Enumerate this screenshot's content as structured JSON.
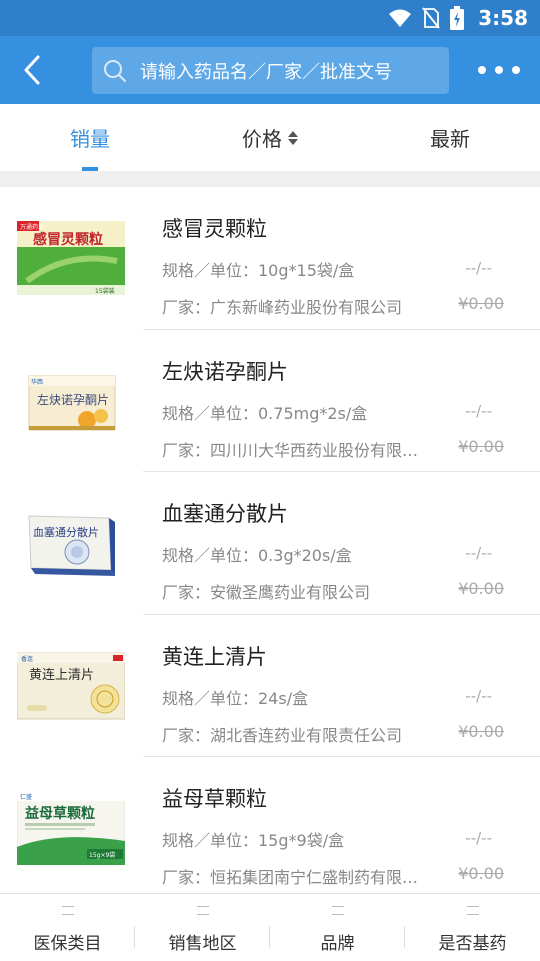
{
  "status_bar": {
    "time": "3:58"
  },
  "search": {
    "placeholder": "请输入药品名／厂家／批准文号"
  },
  "tabs": [
    {
      "label": "销量",
      "active": true
    },
    {
      "label": "价格",
      "active": false
    },
    {
      "label": "最新",
      "active": false
    }
  ],
  "products": [
    {
      "name": "感冒灵颗粒",
      "spec": "规格／单位：10g*15袋/盒",
      "maker": "厂家：广东新峰药业股份有限公司",
      "dash": "--/--",
      "price": "¥0.00",
      "box_text": "感冒灵颗粒",
      "box_brand": "万通药业",
      "box_footer": "15袋装"
    },
    {
      "name": "左炔诺孕酮片",
      "spec": "规格／单位：0.75mg*2s/盒",
      "maker": "厂家：四川川大华西药业股份有限公司",
      "dash": "--/--",
      "price": "¥0.00",
      "box_text": "左炔诺孕酮片",
      "box_brand": "华西"
    },
    {
      "name": "血塞通分散片",
      "spec": "规格／单位：0.3g*20s/盒",
      "maker": "厂家：安徽圣鹰药业有限公司",
      "dash": "--/--",
      "price": "¥0.00",
      "box_text": "血塞通分散片"
    },
    {
      "name": "黄连上清片",
      "spec": "规格／单位：24s/盒",
      "maker": "厂家：湖北香连药业有限责任公司",
      "dash": "--/--",
      "price": "¥0.00",
      "box_text": "黄连上清片",
      "box_brand": "香连"
    },
    {
      "name": "益母草颗粒",
      "spec": "规格／单位：15g*9袋/盒",
      "maker": "厂家：恒拓集团南宁仁盛制药有限公司",
      "dash": "--/--",
      "price": "¥0.00",
      "box_text": "益母草颗粒",
      "box_brand": "仁盛",
      "box_footer": "15g×9袋"
    }
  ],
  "filters": [
    {
      "label": "医保类目"
    },
    {
      "label": "销售地区"
    },
    {
      "label": "品牌"
    },
    {
      "label": "是否基药"
    }
  ],
  "colors": {
    "primary": "#3590df",
    "status_bar": "#2f7fcb"
  },
  "icons": {
    "back": "chevron-left-icon",
    "search": "search-icon",
    "more": "more-dots-icon"
  }
}
